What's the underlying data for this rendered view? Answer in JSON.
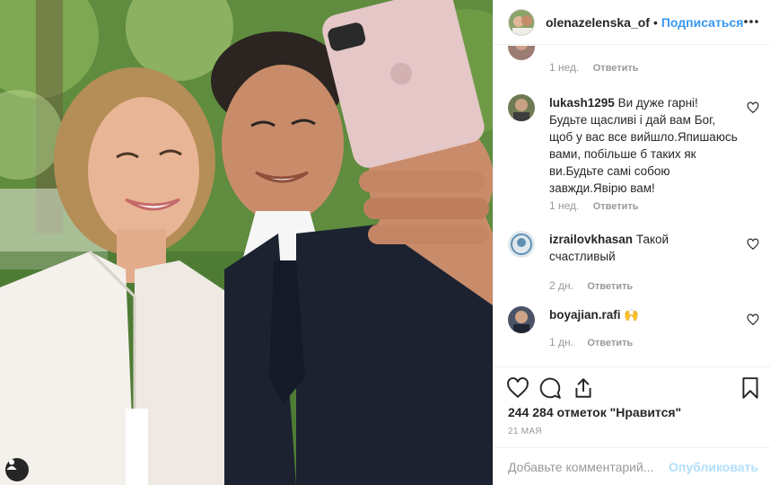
{
  "header": {
    "username": "olenazelenska_of",
    "separator": "•",
    "follow_label": "Подписаться",
    "more_icon": "more-horizontal-icon"
  },
  "comments": [
    {
      "username": "",
      "text": "",
      "time": "1 нед.",
      "reply_label": "Ответить"
    },
    {
      "username": "lukash1295",
      "text": "Ви дуже гарні! Будьте щасливі і дай вам Бог, щоб у вас все вийшло.Япишаюсь вами, побільше б таких як ви.Будьте самі собою завжди.Явірю вам!",
      "time": "1 нед.",
      "reply_label": "Ответить"
    },
    {
      "username": "izrailovkhasan",
      "text": "Такой счастливый",
      "time": "2 дн.",
      "reply_label": "Ответить"
    },
    {
      "username": "boyajian.rafi",
      "text": "🙌",
      "time": "1 дн.",
      "reply_label": "Ответить"
    }
  ],
  "actions": {
    "like_icon": "heart-icon",
    "comment_icon": "comment-icon",
    "share_icon": "share-icon",
    "save_icon": "bookmark-icon",
    "likes_text": "244 284 отметок \"Нравится\"",
    "date_text": "21 МАЯ"
  },
  "add_comment": {
    "placeholder": "Добавьте комментарий...",
    "publish_label": "Опубликовать"
  },
  "colors": {
    "accent": "#3897f0",
    "publish_disabled": "#b2dffc",
    "muted": "#999999",
    "text": "#262626"
  }
}
